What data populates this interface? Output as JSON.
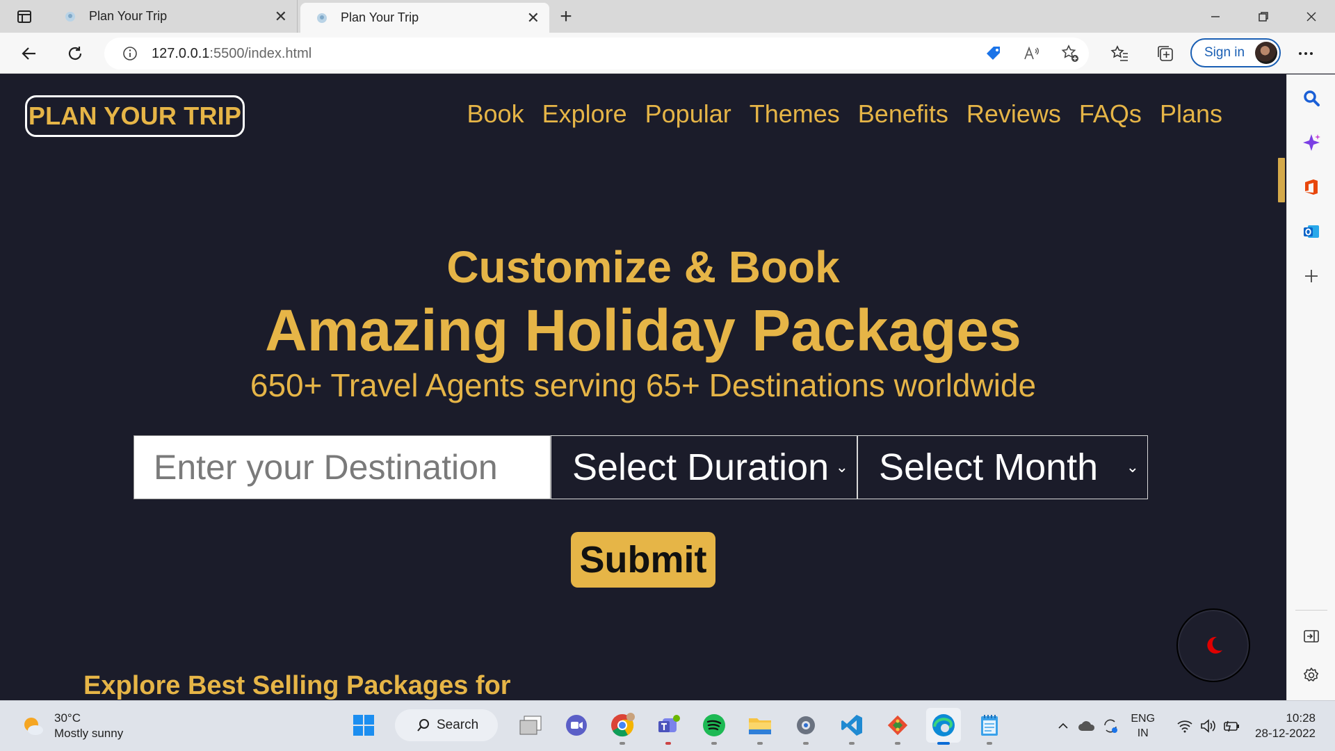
{
  "browser": {
    "tabs": [
      {
        "title": "Plan Your Trip",
        "active": false
      },
      {
        "title": "Plan Your Trip",
        "active": true
      }
    ],
    "url_host": "127.0.0.1",
    "url_rest": ":5500/index.html",
    "sign_in_label": "Sign in"
  },
  "site": {
    "logo": "PLAN YOUR TRIP",
    "nav": [
      "Book",
      "Explore",
      "Popular",
      "Themes",
      "Benefits",
      "Reviews",
      "FAQs",
      "Plans"
    ],
    "hero_subtitle": "Customize & Book",
    "hero_title": "Amazing Holiday Packages",
    "hero_tagline": "650+ Travel Agents serving 65+ Destinations worldwide",
    "destination_placeholder": "Enter your Destination",
    "duration_select": "Select Duration",
    "month_select": "Select Month",
    "submit_label": "Submit",
    "section_title": "Explore Best Selling Packages for",
    "accent_color": "#e6b547",
    "background_color": "#1b1c2a"
  },
  "taskbar": {
    "weather_temp": "30°C",
    "weather_desc": "Mostly sunny",
    "search_label": "Search",
    "lang_line1": "ENG",
    "lang_line2": "IN",
    "time": "10:28",
    "date": "28-12-2022"
  }
}
